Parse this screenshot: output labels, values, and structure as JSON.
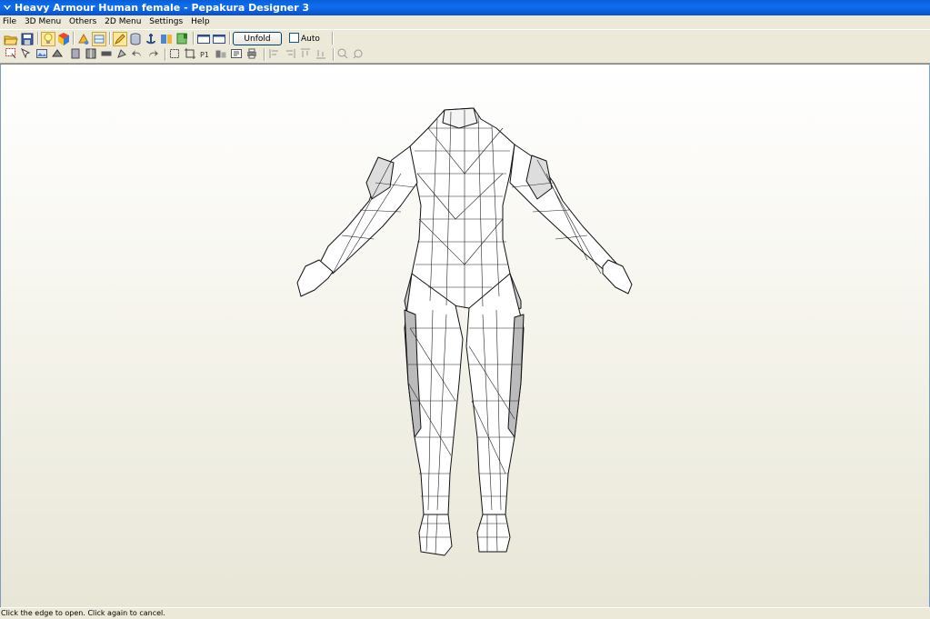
{
  "window": {
    "title": "Heavy Armour Human female - Pepakura Designer 3",
    "titlebar_color": "#0a5fd6"
  },
  "menu": {
    "items": [
      "File",
      "3D Menu",
      "Others",
      "2D Menu",
      "Settings",
      "Help"
    ]
  },
  "toolbar1": {
    "icons": [
      "open-folder-icon",
      "save-icon",
      "lightbulb-icon",
      "texture-cube-icon",
      "paint-icon",
      "texture-paper-icon",
      "pencil-icon",
      "cylinder-icon",
      "anchor-icon",
      "parts-icon",
      "bookmark-icon",
      "window-left-icon",
      "window-right-icon"
    ],
    "unfold_label": "Unfold",
    "auto_label": "Auto",
    "auto_checked": false
  },
  "toolbar2": {
    "icons": [
      "select-icon",
      "edge-select-icon",
      "image-icon",
      "fold-icon",
      "move-part-icon",
      "join-icon",
      "rotate-icon",
      "flip-icon",
      "undo-arrow-icon",
      "redo-arrow-icon",
      "zoom-fit-icon",
      "crop-icon",
      "page-number-icon",
      "layout-icon",
      "text-icon",
      "print-icon",
      "align-left-icon",
      "align-center-icon",
      "align-top-icon",
      "align-bottom-icon",
      "zoom-in-icon",
      "zoom-out-icon"
    ]
  },
  "viewport": {
    "model_description_icon": "wireframe-model-icon"
  },
  "status": {
    "text": "Click the edge to open. Click again to cancel."
  }
}
